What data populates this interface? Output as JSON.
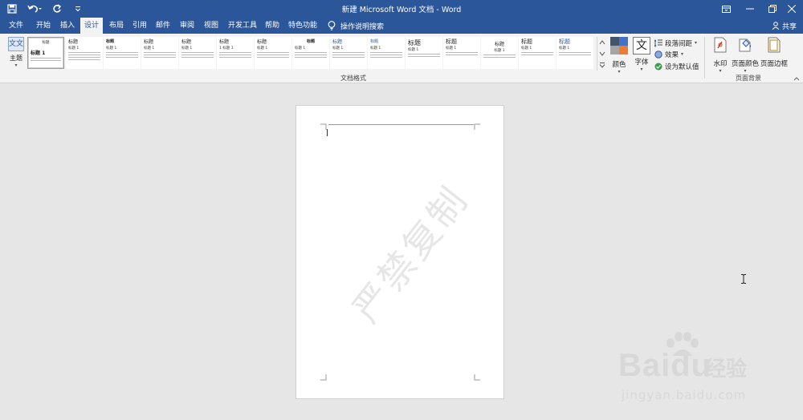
{
  "window": {
    "title": "新建 Microsoft Word 文档 - Word"
  },
  "tabs": [
    {
      "label": "文件",
      "active": false
    },
    {
      "label": "开始",
      "active": false
    },
    {
      "label": "插入",
      "active": false
    },
    {
      "label": "设计",
      "active": true
    },
    {
      "label": "布局",
      "active": false
    },
    {
      "label": "引用",
      "active": false
    },
    {
      "label": "邮件",
      "active": false
    },
    {
      "label": "审阅",
      "active": false
    },
    {
      "label": "视图",
      "active": false
    },
    {
      "label": "开发工具",
      "active": false
    },
    {
      "label": "帮助",
      "active": false
    },
    {
      "label": "特色功能",
      "active": false
    }
  ],
  "tell_me": "操作说明搜索",
  "share": "共享",
  "ribbon": {
    "theme_label": "主题",
    "theme_icon_text": "文文",
    "gallery_group_label": "文档格式",
    "styles": [
      {
        "title": "标题 1",
        "sub": "",
        "selected": true
      },
      {
        "title": "标题",
        "sub": "标题 1",
        "selected": false
      },
      {
        "title": "标题",
        "sub": "标题 1",
        "selected": false
      },
      {
        "title": "标题",
        "sub": "标题 1",
        "selected": false
      },
      {
        "title": "标题",
        "sub": "标题 1",
        "selected": false
      },
      {
        "title": "标题",
        "sub": "1 标题 1",
        "selected": false
      },
      {
        "title": "标题",
        "sub": "标题 1",
        "selected": false
      },
      {
        "title": "标题",
        "sub": "标题 1",
        "selected": false
      },
      {
        "title": "标题",
        "sub": "标题 1",
        "selected": false
      },
      {
        "title": "标题",
        "sub": "标题 1",
        "selected": false
      },
      {
        "title": "标题",
        "sub": "标题 1",
        "selected": false
      },
      {
        "title": "标题",
        "sub": "标题 1",
        "selected": false
      },
      {
        "title": "标题",
        "sub": "标题 1",
        "selected": false
      },
      {
        "title": "标题",
        "sub": "标题 1",
        "selected": false
      },
      {
        "title": "标题",
        "sub": "标题 1",
        "selected": false
      }
    ],
    "colors_label": "颜色",
    "fonts_label": "字体",
    "fonts_icon_text": "文",
    "paragraph_spacing_label": "段落间距",
    "effects_label": "效果",
    "set_default_label": "设为默认值",
    "watermark_label": "水印",
    "page_color_label": "页面颜色",
    "page_border_label": "页面边框",
    "page_bg_group_label": "页面背景"
  },
  "document": {
    "watermark_text": "严禁复制"
  },
  "site_watermark": {
    "brand": "Bai",
    "brand2": "du",
    "cn": "经验",
    "url": "jingyan.baidu.com"
  },
  "colors": {
    "brand_blue": "#2b579a",
    "ribbon_bg": "#f3f3f3",
    "canvas_bg": "#e6e6e6"
  }
}
